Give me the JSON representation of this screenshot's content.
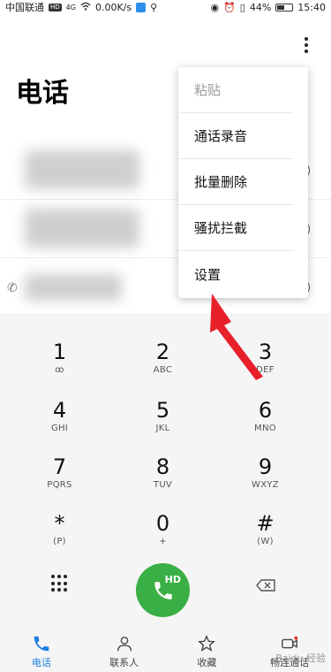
{
  "status_bar": {
    "carrier": "中国联通",
    "hd_badge": "HD",
    "network": "4G",
    "speed": "0.00K/s",
    "battery": "44%",
    "time": "15:40"
  },
  "header": {
    "title": "电话"
  },
  "overflow_menu": {
    "items": [
      {
        "label": "粘贴",
        "enabled": false
      },
      {
        "label": "通话录音",
        "enabled": true
      },
      {
        "label": "批量删除",
        "enabled": true
      },
      {
        "label": "骚扰拦截",
        "enabled": true
      },
      {
        "label": "设置",
        "enabled": true
      }
    ]
  },
  "dialpad": {
    "keys": [
      {
        "digit": "1",
        "letters": "ꝏ"
      },
      {
        "digit": "2",
        "letters": "ABC"
      },
      {
        "digit": "3",
        "letters": "DEF"
      },
      {
        "digit": "4",
        "letters": "GHI"
      },
      {
        "digit": "5",
        "letters": "JKL"
      },
      {
        "digit": "6",
        "letters": "MNO"
      },
      {
        "digit": "7",
        "letters": "PQRS"
      },
      {
        "digit": "8",
        "letters": "TUV"
      },
      {
        "digit": "9",
        "letters": "WXYZ"
      },
      {
        "digit": "*",
        "letters": "(P)"
      },
      {
        "digit": "0",
        "letters": "+"
      },
      {
        "digit": "#",
        "letters": "(W)"
      }
    ],
    "call_hd_label": "HD"
  },
  "bottom_nav": {
    "items": [
      {
        "label": "电话",
        "icon": "phone-icon",
        "active": true
      },
      {
        "label": "联系人",
        "icon": "contacts-icon",
        "active": false
      },
      {
        "label": "收藏",
        "icon": "star-icon",
        "active": false
      },
      {
        "label": "畅连通话",
        "icon": "video-call-icon",
        "active": false
      }
    ]
  },
  "watermark": "Baidu 经验",
  "colors": {
    "accent": "#1e7ee6",
    "call_green": "#3aaf45",
    "annotation_red": "#e8202a"
  }
}
